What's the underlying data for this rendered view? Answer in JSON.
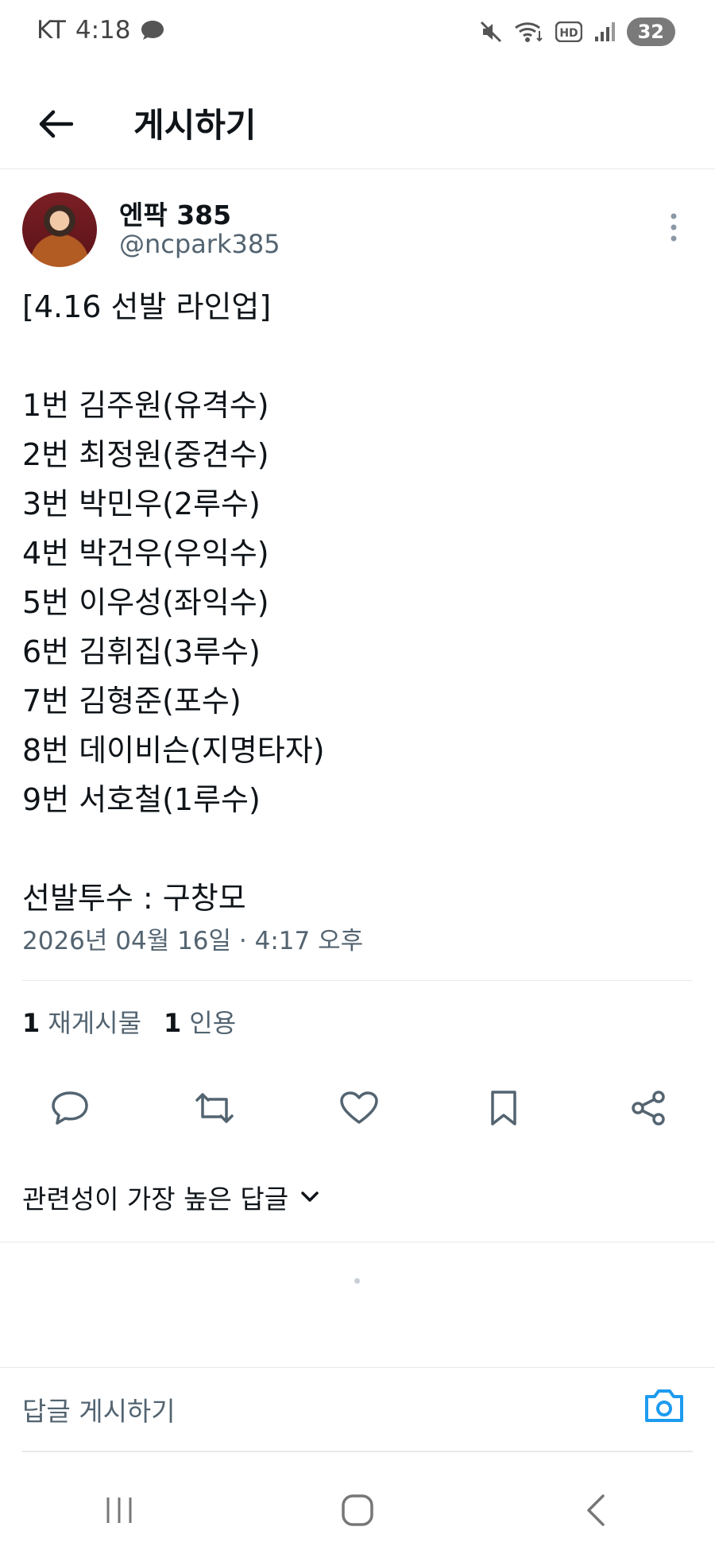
{
  "status": {
    "carrier": "KT",
    "time": "4:18",
    "battery": "32"
  },
  "header": {
    "title": "게시하기"
  },
  "post": {
    "author_name": "엔팍 385",
    "author_handle": "@ncpark385",
    "text": "[4.16 선발 라인업]\n\n1번 김주원(유격수)\n2번 최정원(중견수)\n3번 박민우(2루수)\n4번 박건우(우익수)\n5번 이우성(좌익수)\n6번 김휘집(3루수)\n7번 김형준(포수)\n8번 데이비슨(지명타자)\n9번 서호철(1루수)\n\n선발투수 : 구창모",
    "timestamp": "2026년 04월 16일 · 4:17 오후",
    "repost_count": "1",
    "repost_label": "재게시물",
    "quote_count": "1",
    "quote_label": "인용"
  },
  "replies": {
    "sort_label": "관련성이 가장 높은 답글"
  },
  "reply_box": {
    "placeholder": "답글 게시하기"
  },
  "colors": {
    "accent": "#1d9bf0",
    "secondary_text": "#536471",
    "divider": "#e6e9ec"
  },
  "icons": [
    "back-arrow-icon",
    "more-vertical-icon",
    "reply-icon",
    "repost-icon",
    "like-icon",
    "bookmark-icon",
    "share-icon",
    "chevron-down-icon",
    "camera-icon",
    "recent-apps-icon",
    "home-icon",
    "back-nav-icon"
  ]
}
